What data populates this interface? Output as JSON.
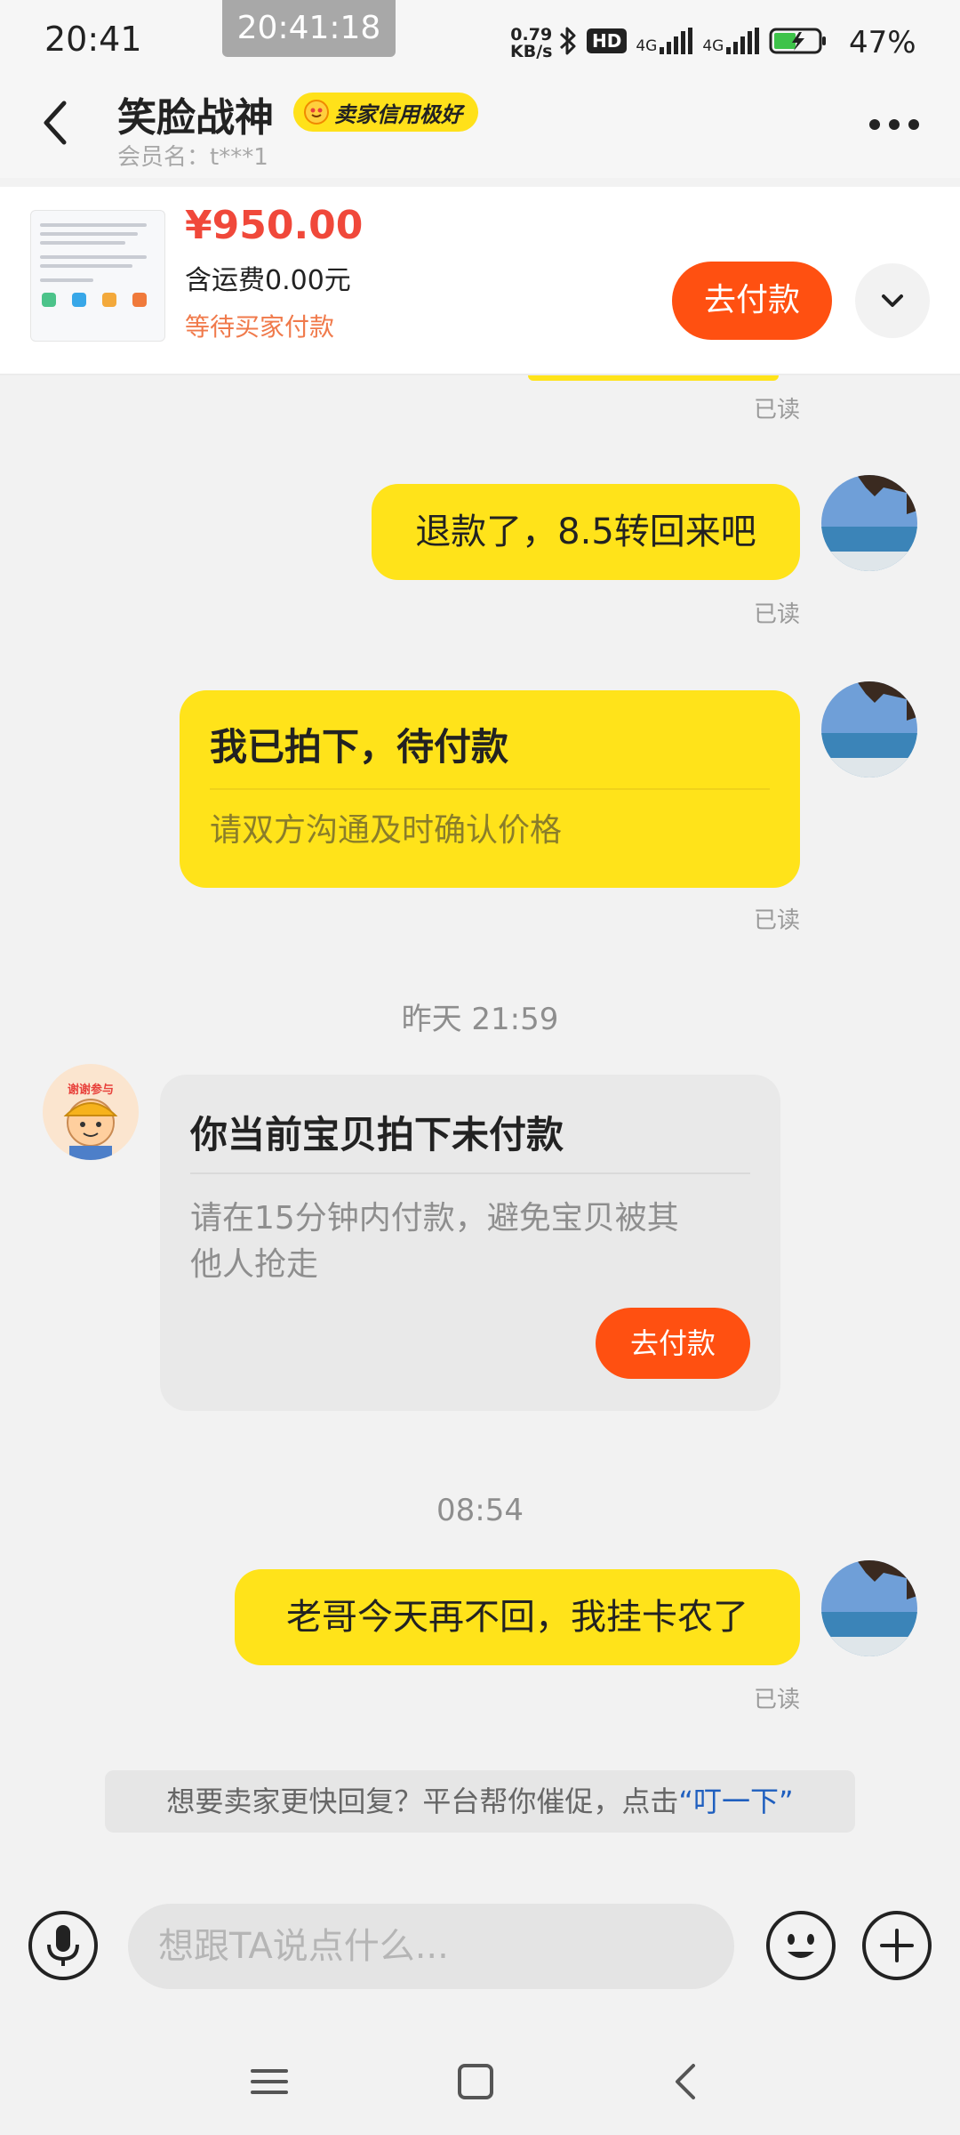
{
  "status_bar": {
    "time": "20:41",
    "overlay_time": "20:41:18",
    "net_speed_value": "0.79",
    "net_speed_unit": "KB/s",
    "hd_label": "HD",
    "network_1": "4G",
    "network_2": "4G",
    "battery": "47%"
  },
  "header": {
    "seller_name": "笑脸战神",
    "credit_badge": "卖家信用极好",
    "member_id": "会员名：t***1",
    "back_icon": "chevron-left-icon",
    "more_icon": "more-horizontal-icon"
  },
  "order": {
    "price": "¥950.00",
    "shipping": "含运费0.00元",
    "status": "等待买家付款",
    "pay_label": "去付款",
    "expand_icon": "chevron-down-icon"
  },
  "messages": [
    {
      "read": "已读"
    },
    {
      "text": "退款了，8.5转回来吧",
      "read": "已读"
    },
    {
      "card_title": "我已拍下，待付款",
      "card_sub": "请双方沟通及时确认价格",
      "read": "已读"
    },
    {
      "timestamp": "昨天 21:59"
    },
    {
      "card_title": "你当前宝贝拍下未付款",
      "card_sub_line1": "请在15分钟内付款，避免宝贝被其",
      "card_sub_line2": "他人抢走",
      "button": "去付款",
      "avatar_text": "谢谢参与"
    },
    {
      "timestamp": "08:54"
    },
    {
      "text": "老哥今天再不回，我挂卡农了",
      "read": "已读"
    }
  ],
  "hint": {
    "text": "想要卖家更快回复？平台帮你催促，点击",
    "link": "“叮一下”"
  },
  "input": {
    "placeholder": "想跟TA说点什么...",
    "mic_icon": "microphone-icon",
    "emoji_icon": "emoji-icon",
    "plus_icon": "plus-icon"
  },
  "nav": {
    "menu_icon": "menu-icon",
    "home_icon": "square-home-icon",
    "back_icon": "triangle-back-icon"
  },
  "colors": {
    "bubble": "#ffe31a",
    "accent_orange": "#ff5011",
    "price_red": "#f0483a",
    "link_blue": "#1f5fbf"
  }
}
